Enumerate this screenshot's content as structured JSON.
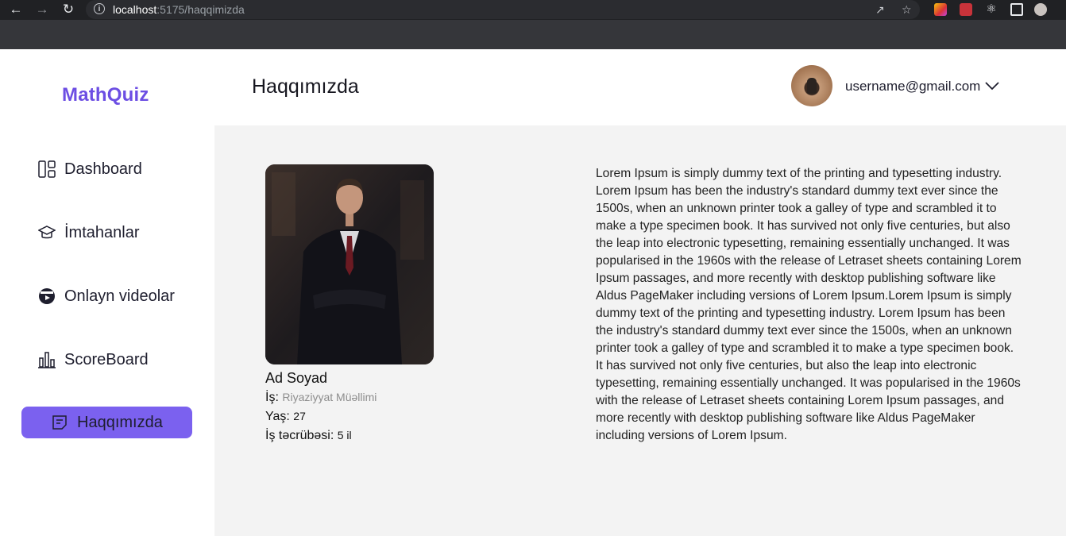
{
  "browser": {
    "url_host": "localhost",
    "url_path": ":5175/haqqimizda",
    "back_icon": "arrow-left-icon",
    "forward_icon": "arrow-right-icon",
    "reload_icon": "reload-icon"
  },
  "sidebar": {
    "logo": "MathQuiz",
    "items": [
      {
        "label": "Dashboard",
        "icon": "dashboard-icon"
      },
      {
        "label": "İmtahanlar",
        "icon": "graduation-cap-icon"
      },
      {
        "label": "Onlayn videolar",
        "icon": "video-icon"
      },
      {
        "label": "ScoreBoard",
        "icon": "bar-chart-icon"
      },
      {
        "label": "Haqqımızda",
        "icon": "note-icon",
        "active": true
      }
    ],
    "accent_color": "#7b61ef"
  },
  "header": {
    "title": "Haqqımızda",
    "user_email": "username@gmail.com"
  },
  "profile": {
    "name": "Ad Soyad",
    "job_label": "İş:",
    "job_value": "Riyaziyyat Müəllimi",
    "age_label": "Yaş:",
    "age_value": "27",
    "experience_label": "İş təcrübəsi:",
    "experience_value": "5 il"
  },
  "about": {
    "text": "Lorem Ipsum is simply dummy text of the printing and typesetting industry. Lorem Ipsum has been the industry's standard dummy text ever since the 1500s, when an unknown printer took a galley of type and scrambled it to make a type specimen book. It has survived not only five centuries, but also the leap into electronic typesetting, remaining essentially unchanged. It was popularised in the 1960s with the release of Letraset sheets containing Lorem Ipsum passages, and more recently with desktop publishing software like Aldus PageMaker including versions of Lorem Ipsum.Lorem Ipsum is simply dummy text of the printing and typesetting industry. Lorem Ipsum has been the industry's standard dummy text ever since the 1500s, when an unknown printer took a galley of type and scrambled it to make a type specimen book. It has survived not only five centuries, but also the leap into electronic typesetting, remaining essentially unchanged. It was popularised in the 1960s with the release of Letraset sheets containing Lorem Ipsum passages, and more recently with desktop publishing software like Aldus PageMaker including versions of Lorem Ipsum."
  }
}
